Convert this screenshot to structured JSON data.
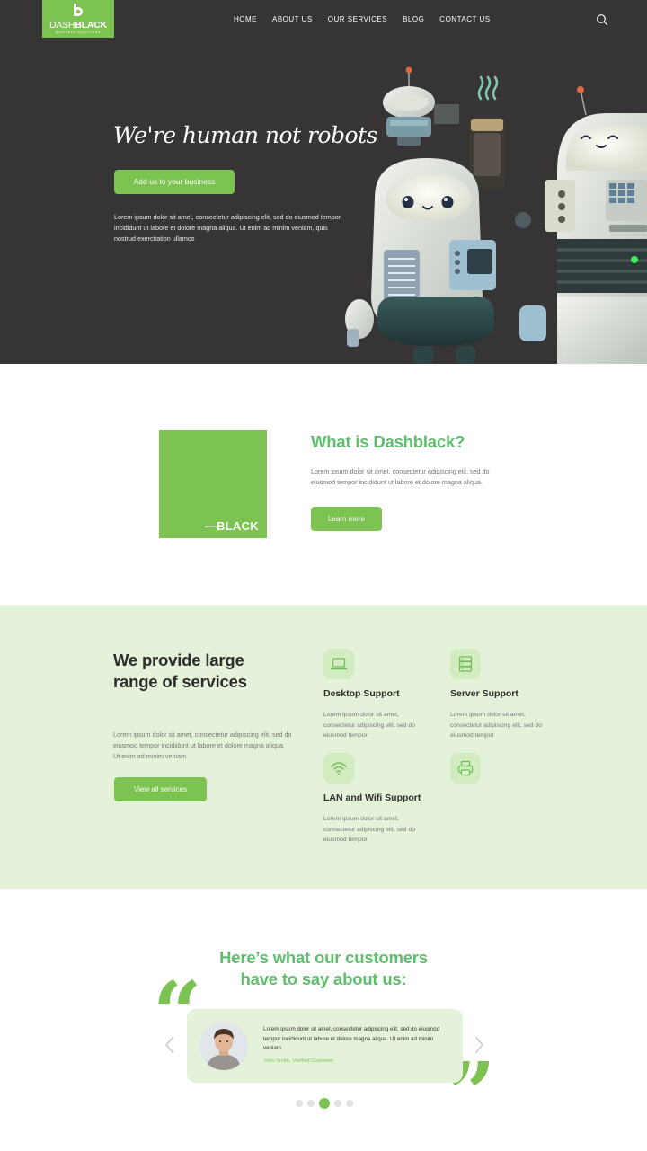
{
  "brand": {
    "name_light": "DASH",
    "name_bold": "BLACK",
    "tagline": "BUSINESS SOLUTIONS",
    "color": "#7cc352"
  },
  "nav": {
    "items": [
      "HOME",
      "ABOUT US",
      "OUR SERVICES",
      "BLOG",
      "CONTACT US"
    ],
    "search_icon": "search-icon"
  },
  "hero": {
    "title": "We're human not robots",
    "cta_label": "Add us to your business",
    "text": "Lorem ipsum dolor sit amet, consectetur adipiscing elit, sed do eiusmod tempor incididunt ut labore et dolore magna aliqua. Ut enim ad minim veniam, quis nostrud exercitation ullamco",
    "background": "#363435"
  },
  "about": {
    "box_text": "—BLACK",
    "title": "What is Dashblack?",
    "text": "Lorem ipsum dolor sit amet, consectetur adipiscing elit, sed do eiusmod tempor incididunt ut labore et dolore magna aliqua.",
    "cta_label": "Learn more"
  },
  "services": {
    "title": "We provide large range of services",
    "text": "Lorem ipsum dolor sit amet, consectetur adipiscing elit, sed do eiusmod tempor incididunt ut labore et dolore magna aliqua. Ut enim ad minim veniam",
    "cta_label": "View all services",
    "background": "#e4f2d9",
    "items": [
      {
        "icon": "laptop-icon",
        "name": "Desktop Support",
        "desc": "Lorem ipsum dolor sit amet, consectetur adipiscing elit, sed do eiusmod tempor"
      },
      {
        "icon": "server-icon",
        "name": "Server Support",
        "desc": "Lorem ipsum dolor sit amet, consectetur adipiscing elit, sed do eiusmod tempor"
      },
      {
        "icon": "wifi-icon",
        "name": "LAN and Wifi Support",
        "desc": "Lorem ipsum dolor sit amet, consectetur adipiscing elit, sed do eiusmod tempor"
      },
      {
        "icon": "printer-icon",
        "name": "",
        "desc": ""
      }
    ]
  },
  "testimonials": {
    "title": "Here’s what our customers have to say about us:",
    "quote": "Lorem ipsum dolor sit amet, consectetur adipiscing elit, sed do eiusmod tempor incididunt ut labore et dolore magna aliqua. Ut enim ad minim veniam",
    "author": "John Smith, Verified Customer",
    "slide_count": 5,
    "active_slide": 3
  }
}
